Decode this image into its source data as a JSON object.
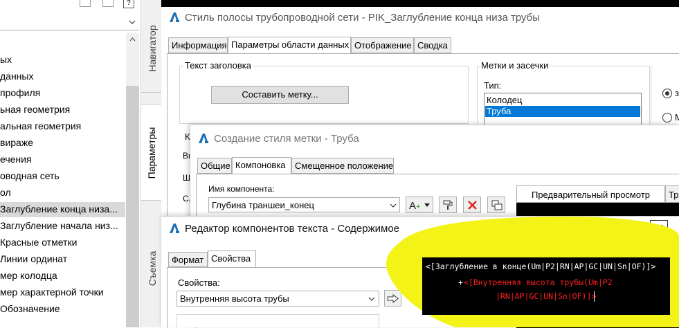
{
  "left_panel": {
    "items": [
      "ых",
      "данных",
      "профиля",
      "ьная геометрия",
      "альная геометрия",
      " вираже",
      "ечения",
      "оводная сеть",
      "ол",
      "Заглубление конца низа...",
      "Заглубление начала низ...",
      "Красные отметки",
      "Линии ординат",
      "мер колодца",
      "мер характерной точки",
      "Обозначение"
    ],
    "selected_index": 9
  },
  "side_tabs": {
    "navigator": "Навигатор",
    "parameters": "Параметры",
    "survey": "Съемка"
  },
  "main_dialog": {
    "title": "Стиль полосы трубопроводной сети - PIK_Заглубление конца низа трубы",
    "tabs": [
      "Информация",
      "Параметры области данных",
      "Отображение",
      "Сводка"
    ],
    "header_text_group": "Текст заголовка",
    "compose_label_button": "Составить метку...",
    "marks_group": "Метки и засечки",
    "type_label": "Тип:",
    "type_list": [
      "Колодец",
      "Труба"
    ],
    "type_selected_index": 1,
    "radio1": "з",
    "radio2": "М",
    "partial_labels": [
      "К",
      "Вы",
      "Ш",
      "Сл"
    ]
  },
  "label_style_dialog": {
    "title": "Создание стиля метки - Труба",
    "tabs": [
      "Общие",
      "Компоновка",
      "Смещенное положение"
    ],
    "component_name_label": "Имя компонента:",
    "component_name_value": "Глубина траншеи_конец",
    "preview_tab": "Предварительный просмотр",
    "preview_tab2": "Тр"
  },
  "text_editor_dialog": {
    "title": "Редактор компонентов текста - Содержимое",
    "tabs": [
      "Формат",
      "Свойства"
    ],
    "properties_label": "Свойства:",
    "properties_value": "Внутренняя высота трубы",
    "code_line1": "<[Заглубление в конце(Um|P2|RN|AP|GC|UN|Sn|OF)]>",
    "code_line2_prefix": "+",
    "code_line2": "<[Внутренняя высота трубы(Um|P2",
    "code_line3": "|RN|AP|GC|UN|Sn|OF)]>"
  },
  "colors": {
    "highlight": "#f3f318",
    "selection": "#0078d7",
    "code_white": "#ffffff",
    "code_red": "#ff2020",
    "code_bg": "#000000"
  },
  "icons": [
    "autocad-a-icon",
    "add-text-icon",
    "dropdown-arrow-icon",
    "paintbrush-icon",
    "delete-icon",
    "copy-icon",
    "close-icon",
    "arrow-right-icon",
    "chevron-down-icon",
    "scroll-up-icon"
  ]
}
